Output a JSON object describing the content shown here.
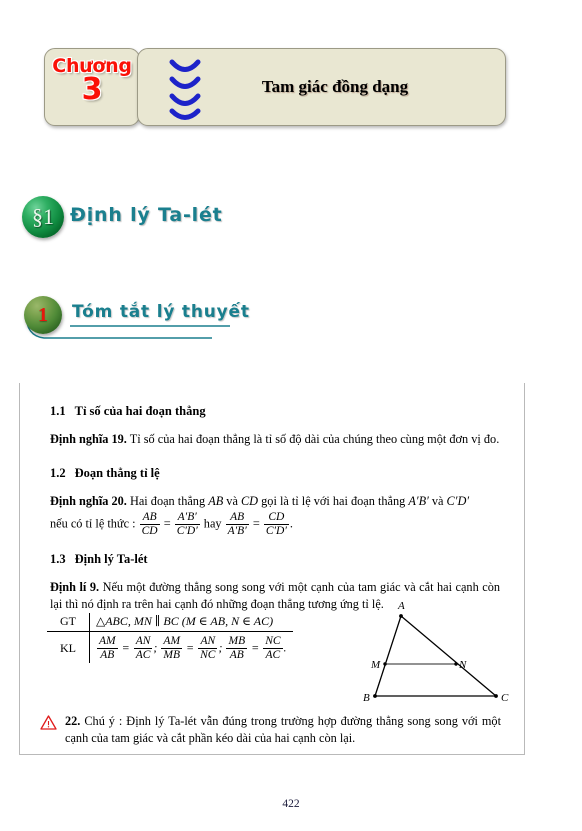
{
  "chapter": {
    "label": "Chương",
    "number": "3",
    "title": "Tam giác đồng dạng",
    "panel_color": "#e9e7d2",
    "label_color": "#fa1107",
    "spiral_color": "#1d23c9"
  },
  "section": {
    "badge": "§1",
    "title": "Định lý Ta-lét",
    "title_color": "#1a7f8e",
    "badge_color": "#108c41"
  },
  "subsection": {
    "badge": "1",
    "title": "Tóm tắt lý thuyết",
    "title_color": "#1a7f8e",
    "badge_number_color": "#e8170b",
    "underline_color": "#1a7f8e"
  },
  "content": {
    "sub_1_1": {
      "num": "1.1",
      "heading": "Tỉ số của hai đoạn thẳng",
      "def_label": "Định nghĩa 19.",
      "def_text": "Tỉ số của hai đoạn thẳng là tỉ số độ dài của chúng theo cùng một đơn vị đo."
    },
    "sub_1_2": {
      "num": "1.2",
      "heading": "Đoạn thẳng tỉ lệ",
      "def_label": "Định nghĩa 20.",
      "def_text_part1": "Hai đoạn thẳng",
      "seg1": "AB",
      "conj1": "và",
      "seg2": "CD",
      "def_text_part2": "gọi là tỉ lệ với hai đoạn thẳng",
      "seg3": "A′B′",
      "conj2": "và",
      "seg4": "C′D′",
      "def_text_part3": "nếu có tỉ lệ thức :",
      "eq1_num": "AB",
      "eq1_den": "CD",
      "eq1_rhs_num": "A′B′",
      "eq1_rhs_den": "C′D′",
      "eq_joiner": "hay",
      "eq2_num": "AB",
      "eq2_den": "A′B′",
      "eq2_rhs_num": "CD",
      "eq2_rhs_den": "C′D′",
      "eq_end": "."
    },
    "sub_1_3": {
      "num": "1.3",
      "heading": "Định lý Ta-lét",
      "thm_label": "Định lí 9.",
      "thm_text": "Nếu một đường thẳng song song với một cạnh của tam giác và cắt hai cạnh còn lại thì nó định ra trên hai cạnh đó những đoạn thẳng tương ứng tỉ lệ."
    }
  },
  "gt_kl": {
    "gt_label": "GT",
    "gt_value": "△ABC, MN ∥ BC (M ∈ AB, N ∈ AC)",
    "kl_label": "KL",
    "kl_fractions": [
      {
        "lnum": "AM",
        "lden": "AB",
        "rnum": "AN",
        "rden": "AC",
        "sep": ";"
      },
      {
        "lnum": "AM",
        "lden": "MB",
        "rnum": "AN",
        "rden": "NC",
        "sep": ";"
      },
      {
        "lnum": "MB",
        "lden": "AB",
        "rnum": "NC",
        "rden": "AC",
        "sep": "."
      }
    ]
  },
  "figure": {
    "vertex_A": "A",
    "vertex_B": "B",
    "vertex_C": "C",
    "point_M": "M",
    "point_N": "N",
    "line_color": "#000000",
    "mn_color": "#6e6e6e"
  },
  "note": {
    "icon": "warning-triangle-icon",
    "icon_color": "#e01b1b",
    "number": "22.",
    "text": "Chú ý :  Định lý Ta-lét vẫn đúng trong trường hợp đường thẳng song song với một cạnh của tam giác và cắt phần kéo dài của hai cạnh còn lại."
  },
  "footer": {
    "page_number": "422"
  }
}
